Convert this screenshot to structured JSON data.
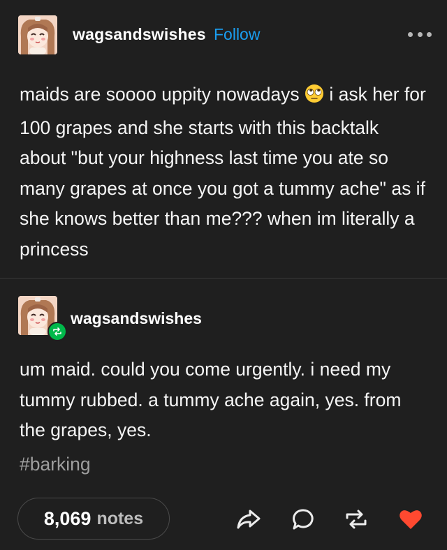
{
  "post": {
    "author": "wagsandswishes",
    "follow_label": "Follow",
    "text_before_emoji": "maids are soooo uppity nowadays ",
    "emoji_icon": "eye-roll-emoji",
    "text_after_emoji": " i ask her for 100 grapes and she starts with this backtalk about \"but your highness last time you ate so many grapes at once you got a tummy ache\" as if she knows better than me??? when im literally a princess"
  },
  "reblog": {
    "author": "wagsandswishes",
    "text": "um maid. could you come urgently. i need my tummy rubbed. a tummy ache again, yes. from the grapes, yes.",
    "tag": "#barking"
  },
  "footer": {
    "notes_count": "8,069",
    "notes_label": "notes",
    "icons": [
      "share-icon",
      "reply-icon",
      "reblog-icon",
      "like-heart-icon"
    ]
  },
  "colors": {
    "background": "#1f1f1f",
    "accent_blue": "#1a9ef0",
    "reblog_green": "#00b84a",
    "like_red": "#ff4930"
  }
}
